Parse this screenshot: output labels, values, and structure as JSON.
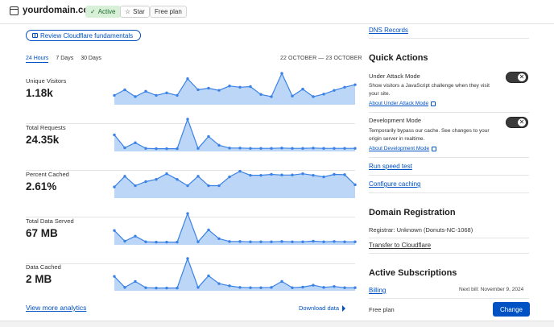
{
  "header": {
    "domain": "yourdomain.com",
    "status": "Active",
    "star_label": "Star",
    "plan_badge": "Free plan",
    "colors": {
      "active_bg": "#d8f0d8",
      "active_text": "#1c6b2c"
    }
  },
  "review_button": "Review Cloudflare fundamentals",
  "time_ranges": [
    {
      "label": "24 Hours",
      "active": true
    },
    {
      "label": "7 Days",
      "active": false
    },
    {
      "label": "30 Days",
      "active": false
    }
  ],
  "date_range": "22 OCTOBER — 23 OCTOBER",
  "metrics": [
    {
      "label": "Unique Visitors",
      "value": "1.18k"
    },
    {
      "label": "Total Requests",
      "value": "24.35k"
    },
    {
      "label": "Percent Cached",
      "value": "2.61%"
    },
    {
      "label": "Total Data Served",
      "value": "67 MB"
    },
    {
      "label": "Data Cached",
      "value": "2 MB"
    }
  ],
  "chart_data": [
    {
      "type": "area",
      "name": "Unique Visitors",
      "ylim": [
        0,
        1
      ],
      "values": [
        0.22,
        0.4,
        0.18,
        0.35,
        0.22,
        0.3,
        0.22,
        0.75,
        0.4,
        0.45,
        0.38,
        0.52,
        0.48,
        0.5,
        0.25,
        0.18,
        0.92,
        0.2,
        0.42,
        0.18,
        0.26,
        0.38,
        0.48,
        0.56
      ]
    },
    {
      "type": "area",
      "name": "Total Requests",
      "ylim": [
        0,
        1
      ],
      "values": [
        0.45,
        0.04,
        0.2,
        0.02,
        0.01,
        0.01,
        0.01,
        0.95,
        0.02,
        0.4,
        0.12,
        0.03,
        0.03,
        0.02,
        0.02,
        0.02,
        0.03,
        0.02,
        0.02,
        0.03,
        0.02,
        0.02,
        0.02,
        0.02
      ]
    },
    {
      "type": "area",
      "name": "Percent Cached",
      "ylim": [
        0,
        1
      ],
      "values": [
        0.28,
        0.62,
        0.32,
        0.45,
        0.52,
        0.7,
        0.52,
        0.32,
        0.62,
        0.32,
        0.32,
        0.6,
        0.78,
        0.65,
        0.65,
        0.68,
        0.66,
        0.66,
        0.7,
        0.65,
        0.6,
        0.68,
        0.67,
        0.35
      ]
    },
    {
      "type": "area",
      "name": "Total Data Served",
      "ylim": [
        0,
        1
      ],
      "values": [
        0.38,
        0.04,
        0.2,
        0.02,
        0.01,
        0.01,
        0.01,
        0.92,
        0.02,
        0.4,
        0.12,
        0.03,
        0.03,
        0.02,
        0.02,
        0.02,
        0.03,
        0.02,
        0.02,
        0.04,
        0.02,
        0.03,
        0.02,
        0.02
      ]
    },
    {
      "type": "area",
      "name": "Data Cached",
      "ylim": [
        0,
        1
      ],
      "values": [
        0.38,
        0.03,
        0.22,
        0.02,
        0.01,
        0.01,
        0.01,
        0.95,
        0.03,
        0.4,
        0.15,
        0.08,
        0.03,
        0.02,
        0.02,
        0.03,
        0.22,
        0.02,
        0.04,
        0.1,
        0.03,
        0.06,
        0.02,
        0.02
      ]
    }
  ],
  "chart_colors": {
    "line": "#3a82e6",
    "fill": "#bcd6f7"
  },
  "view_more": "View more analytics",
  "download": "Download data",
  "right": {
    "dns_link": "DNS Records",
    "quick_actions_title": "Quick Actions",
    "under_attack": {
      "title": "Under Attack Mode",
      "description": "Show visitors a JavaScript challenge when they visit your site.",
      "link": "About Under Attack Mode",
      "enabled": false
    },
    "development": {
      "title": "Development Mode",
      "description": "Temporarily bypass our cache. See changes to your origin server in realtime.",
      "link": "About Development Mode",
      "enabled": false
    },
    "run_speed_test": "Run speed test",
    "configure_caching": "Configure caching",
    "domain_registration_title": "Domain Registration",
    "registrar": "Registrar: Unknown (Donuts-NC-1068)",
    "transfer_link": "Transfer to Cloudflare",
    "subscriptions_title": "Active Subscriptions",
    "billing_link": "Billing",
    "next_bill": "Next bill: November 9, 2024",
    "plan": "Free plan",
    "change_button": "Change"
  }
}
